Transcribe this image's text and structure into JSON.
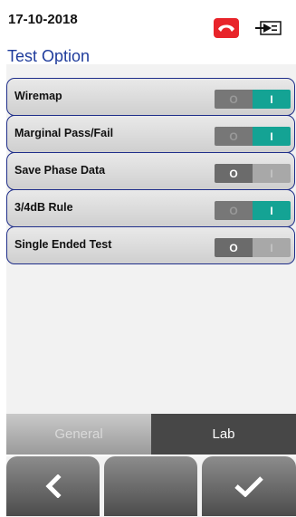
{
  "status_bar": {
    "date": "17-10-2018",
    "icons": [
      "phone-hangup-icon",
      "power-plug-icon"
    ],
    "phone_icon_color": "#e8242a"
  },
  "page": {
    "title": "Test Option"
  },
  "options": [
    {
      "label": "Wiremap",
      "state": "on"
    },
    {
      "label": "Marginal Pass/Fail",
      "state": "on"
    },
    {
      "label": "Save Phase Data",
      "state": "off"
    },
    {
      "label": "3/4dB Rule",
      "state": "on"
    },
    {
      "label": "Single Ended Test",
      "state": "off"
    }
  ],
  "toggle": {
    "off_label": "O",
    "on_label": "I",
    "on_color": "#14a394"
  },
  "tabs": [
    {
      "label": "General",
      "active": false
    },
    {
      "label": "Lab",
      "active": true
    }
  ],
  "nav": {
    "buttons": [
      "back-chevron-icon",
      "blank",
      "checkmark-icon"
    ]
  },
  "colors": {
    "title": "#1f3c9c",
    "row_border": "#1f2e8a"
  }
}
